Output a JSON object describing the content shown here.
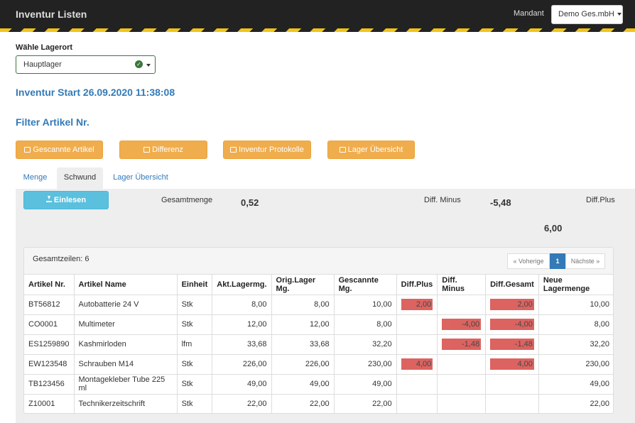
{
  "navbar": {
    "brand": "Inventur Listen",
    "mandant_label": "Mandant",
    "mandant_value": "Demo Ges.mbH"
  },
  "lager": {
    "label": "Wähle Lagerort",
    "value": "Hauptlager"
  },
  "inventur_title": "Inventur Start 26.09.2020 11:38:08",
  "filter_title": "Filter Artikel Nr.",
  "buttons": {
    "gescannte": "Gescannte Artikel",
    "differenz": "Differenz",
    "protokolle": "Inventur Protokolle",
    "lager_uebersicht": "Lager Übersicht",
    "einlesen": "Einlesen"
  },
  "tabs": [
    "Menge",
    "Schwund",
    "Lager Übersicht"
  ],
  "active_tab": "Schwund",
  "stats": {
    "gesamtmenge_label": "Gesamtmenge",
    "gesamtmenge_value": "0,52",
    "diff_minus_label": "Diff. Minus",
    "diff_minus_value": "-5,48",
    "diff_plus_label": "Diff.Plus",
    "diff_plus_value": "6,00"
  },
  "table": {
    "gesamtzeilen": "Gesamtzeilen: 6",
    "pager": {
      "prev": "« Voherige",
      "page": "1",
      "next": "Nächste »"
    },
    "columns": [
      "Artikel Nr.",
      "Artikel Name",
      "Einheit",
      "Akt.Lagermg.",
      "Orig.Lager Mg.",
      "Gescannte Mg.",
      "Diff.Plus",
      "Diff. Minus",
      "Diff.Gesamt",
      "Neue Lagermenge"
    ],
    "rows": [
      [
        "BT56812",
        "Autobatterie 24 V",
        "Stk",
        "8,00",
        "8,00",
        "10,00",
        "2,00",
        "",
        "2,00",
        "10,00"
      ],
      [
        "CO0001",
        "Multimeter",
        "Stk",
        "12,00",
        "12,00",
        "8,00",
        "",
        "-4,00",
        "-4,00",
        "8,00"
      ],
      [
        "ES1259890",
        "Kashmirloden",
        "lfm",
        "33,68",
        "33,68",
        "32,20",
        "",
        "-1,48",
        "-1,48",
        "32,20"
      ],
      [
        "EW123548",
        "Schrauben M14",
        "Stk",
        "226,00",
        "226,00",
        "230,00",
        "4,00",
        "",
        "4,00",
        "230,00"
      ],
      [
        "TB123456",
        "Montagekleber Tube 225 ml",
        "Stk",
        "49,00",
        "49,00",
        "49,00",
        "",
        "",
        "",
        "49,00"
      ],
      [
        "Z10001",
        "Technikerzeitschrift",
        "Stk",
        "22,00",
        "22,00",
        "22,00",
        "",
        "",
        "",
        "22,00"
      ]
    ]
  },
  "colors": {
    "navbar": "#222222",
    "accent": "#337ab7",
    "warning": "#f0ad4e",
    "info": "#5bc0de",
    "danger": "#d9534f"
  }
}
